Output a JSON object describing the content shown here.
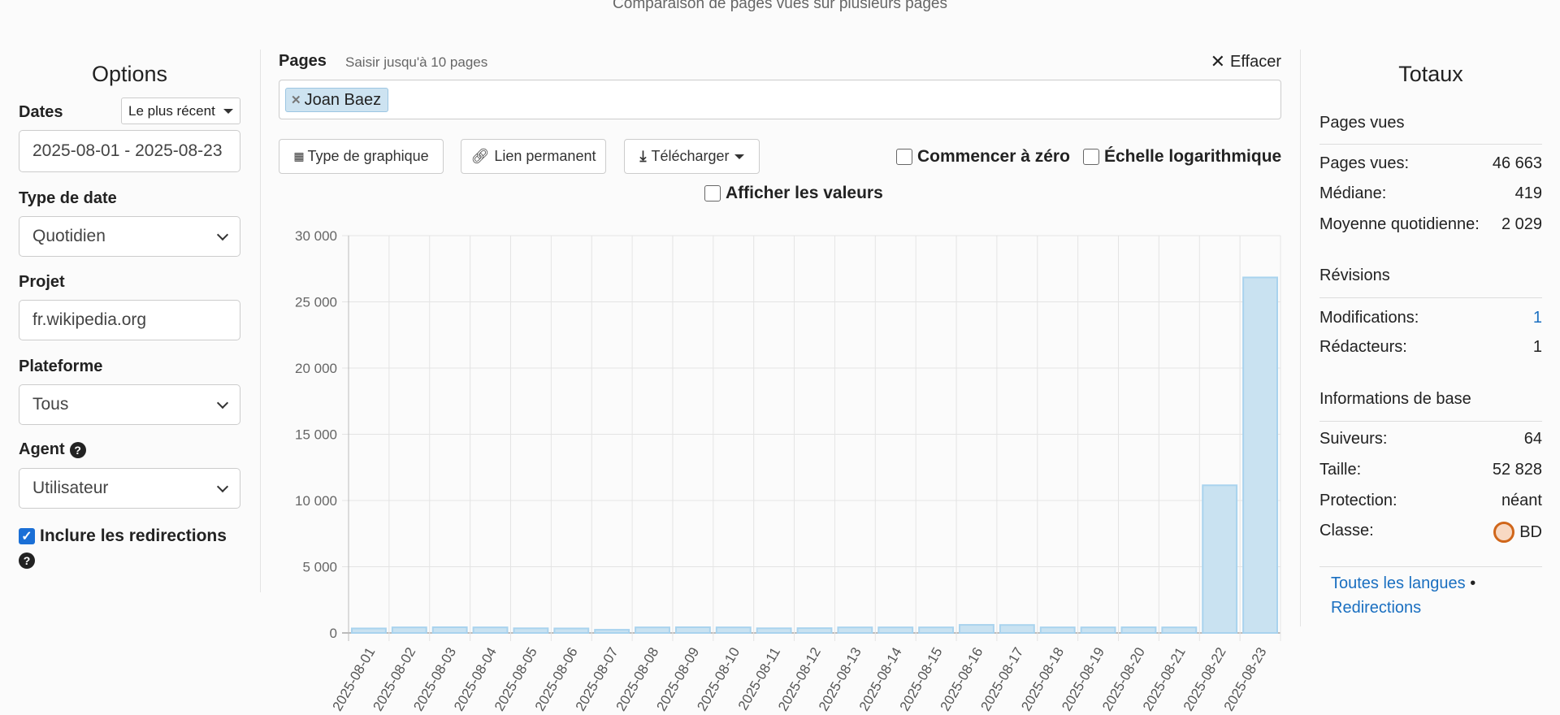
{
  "page_title": "Comparaison de pages vues sur plusieurs pages",
  "options": {
    "heading": "Options",
    "dates_label": "Dates",
    "dates_preset": "Le plus récent",
    "dates_value": "2025-08-01 - 2025-08-23",
    "date_type_label": "Type de date",
    "date_type_value": "Quotidien",
    "project_label": "Projet",
    "project_value": "fr.wikipedia.org",
    "platform_label": "Plateforme",
    "platform_value": "Tous",
    "agent_label": "Agent",
    "agent_value": "Utilisateur",
    "redirects_label": "Inclure les redirections",
    "redirects_checked": true
  },
  "pages": {
    "label": "Pages",
    "hint": "Saisir jusqu'à 10 pages",
    "clear_label": "Effacer",
    "tags": [
      "Joan Baez"
    ]
  },
  "toolbar": {
    "chart_type": "Type de graphique",
    "permalink": "Lien permanent",
    "download": "Télécharger",
    "begin_zero": "Commencer à zéro",
    "log_scale": "Échelle logarithmique",
    "show_values": "Afficher les valeurs"
  },
  "colors": {
    "bar_fill": "#c9e2f1",
    "bar_stroke": "#a9d3ee",
    "link": "#1a6fc0"
  },
  "chart_data": {
    "type": "bar",
    "title": "",
    "xlabel": "",
    "ylabel": "",
    "ylim": [
      0,
      30000
    ],
    "yticks": [
      0,
      5000,
      10000,
      15000,
      20000,
      25000,
      30000
    ],
    "ytick_labels": [
      "0",
      "5 000",
      "10 000",
      "15 000",
      "20 000",
      "25 000",
      "30 000"
    ],
    "grid": true,
    "categories": [
      "2025-08-01",
      "2025-08-02",
      "2025-08-03",
      "2025-08-04",
      "2025-08-05",
      "2025-08-06",
      "2025-08-07",
      "2025-08-08",
      "2025-08-09",
      "2025-08-10",
      "2025-08-11",
      "2025-08-12",
      "2025-08-13",
      "2025-08-14",
      "2025-08-15",
      "2025-08-16",
      "2025-08-17",
      "2025-08-18",
      "2025-08-19",
      "2025-08-20",
      "2025-08-21",
      "2025-08-22",
      "2025-08-23"
    ],
    "series": [
      {
        "name": "Joan Baez",
        "values": [
          340,
          420,
          430,
          420,
          350,
          340,
          240,
          420,
          430,
          420,
          350,
          360,
          419,
          420,
          419,
          610,
          600,
          419,
          419,
          425,
          419,
          11150,
          26843
        ]
      }
    ]
  },
  "totals": {
    "heading": "Totaux",
    "pageviews_heading": "Pages vues",
    "pageviews": [
      {
        "label": "Pages vues:",
        "value": "46 663"
      },
      {
        "label": "Médiane:",
        "value": "419"
      },
      {
        "label": "Moyenne quotidienne:",
        "value": "2 029"
      }
    ],
    "revisions_heading": "Révisions",
    "revisions": [
      {
        "label": "Modifications:",
        "value": "1"
      },
      {
        "label": "Rédacteurs:",
        "value": "1"
      }
    ],
    "basic_heading": "Informations de base",
    "basic": [
      {
        "label": "Suiveurs:",
        "value": "64"
      },
      {
        "label": "Taille:",
        "value": "52 828"
      },
      {
        "label": "Protection:",
        "value": "néant"
      },
      {
        "label": "Classe:",
        "value": "BD"
      }
    ],
    "links": {
      "all_languages": "Toutes les langues",
      "redirects": "Redirections"
    }
  }
}
